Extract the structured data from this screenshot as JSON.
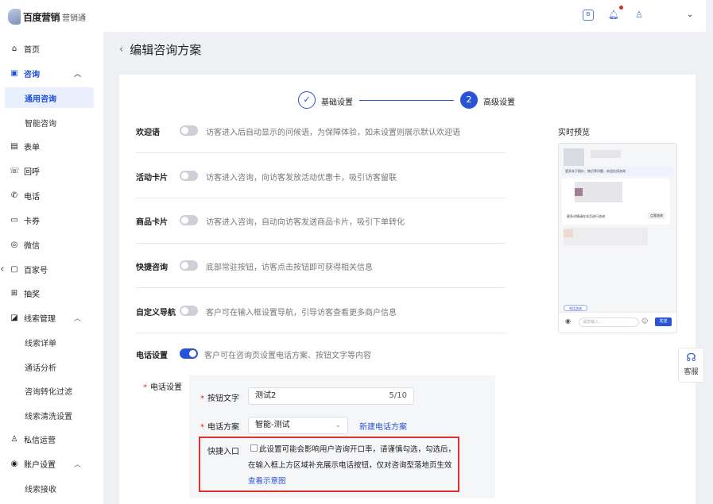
{
  "brand": {
    "name": "百度营销",
    "sub": "营销通"
  },
  "sidebar": {
    "items": [
      {
        "label": "首页",
        "icon": "home-icon"
      },
      {
        "label": "咨询",
        "icon": "chat-box-icon"
      },
      {
        "label": "通用咨询"
      },
      {
        "label": "智能咨询"
      },
      {
        "label": "表单",
        "icon": "form-icon"
      },
      {
        "label": "回呼",
        "icon": "callback-icon"
      },
      {
        "label": "电话",
        "icon": "phone-icon"
      },
      {
        "label": "卡券",
        "icon": "coupon-icon"
      },
      {
        "label": "微信",
        "icon": "wechat-icon"
      },
      {
        "label": "百家号",
        "icon": "baijiahao-icon"
      },
      {
        "label": "抽奖",
        "icon": "gift-icon"
      },
      {
        "label": "线索管理",
        "icon": "chart-icon"
      },
      {
        "label": "线索详单"
      },
      {
        "label": "通话分析"
      },
      {
        "label": "咨询转化过滤"
      },
      {
        "label": "线索清洗设置"
      },
      {
        "label": "私信运营",
        "icon": "message-ops-icon"
      },
      {
        "label": "账户设置",
        "icon": "settings-icon"
      },
      {
        "label": "线索接收"
      }
    ]
  },
  "page": {
    "title": "编辑咨询方案"
  },
  "steps": [
    {
      "label": "基础设置"
    },
    {
      "number": "2",
      "label": "高级设置"
    }
  ],
  "settings": [
    {
      "label": "欢迎语",
      "desc": "访客进入后自动显示的问候语，为保障体验，如未设置则展示默认欢迎语",
      "on": false
    },
    {
      "label": "活动卡片",
      "desc": "访客进入咨询，向访客发放活动优惠卡，吸引访客留联",
      "on": false
    },
    {
      "label": "商品卡片",
      "desc": "访客进入咨询，自动向访客发送商品卡片，吸引下单转化",
      "on": false
    },
    {
      "label": "快捷咨询",
      "desc": "底部常驻按钮，访客点击按钮即可获得相关信息",
      "on": false
    },
    {
      "label": "自定义导航",
      "desc": "客户可在输入框设置导航，引导访客查看更多商户信息",
      "on": false
    },
    {
      "label": "电话设置",
      "desc": "客户可在咨询页设置电话方案、按钮文字等内容",
      "on": true
    }
  ],
  "phone_config": {
    "label": "电话设置",
    "button_text_label": "按钮文字",
    "button_text_value": "测试2",
    "button_text_count": "5/10",
    "plan_label": "电话方案",
    "plan_value": "智能-测试",
    "new_plan_link": "新建电话方案",
    "quick_entry_label": "快捷入口",
    "quick_entry_checked": false,
    "quick_entry_text": "此设置可能会影响用户咨询开口率，请谨慎勾选，勾选后，在输入框上方区域补充展示电话按钮，仅对咨询型落地页生效",
    "quick_entry_link": "查看示意图"
  },
  "preview": {
    "title": "实时预览",
    "input_placeholder": "请您输入...",
    "send": "发送",
    "chip": "电话咨询",
    "card_hint": "更多详情请在本页进行咨询",
    "card_button": "点我咨询",
    "banner": "更多关于报价、售后等问题，欢迎在线咨询"
  },
  "kefu": {
    "label": "客服"
  }
}
